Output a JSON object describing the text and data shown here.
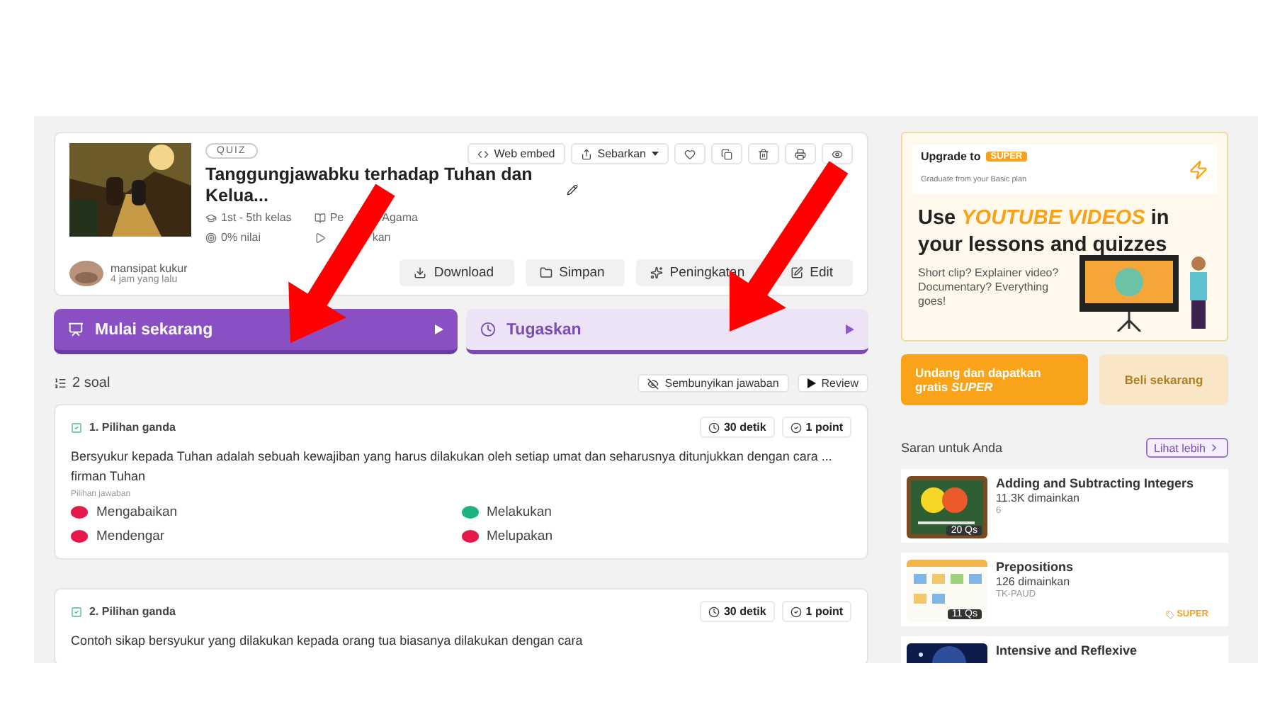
{
  "quiz": {
    "badge": "QUIZ",
    "title": "Tanggungjawabku terhadap Tuhan dan Kelua...",
    "meta": [
      {
        "kind": "grade",
        "text": "1st - 5th kelas"
      },
      {
        "kind": "subject",
        "parts": [
          "Pe",
          "Agama"
        ]
      },
      {
        "kind": "accuracy",
        "text": "0% nilai"
      },
      {
        "kind": "plays",
        "parts": [
          "kan"
        ]
      }
    ],
    "author": {
      "name": "mansipat kukur",
      "time": "4 jam yang lalu"
    },
    "toolbar": [
      {
        "kind": "embed",
        "label": "Web embed"
      },
      {
        "kind": "share",
        "label": "Sebarkan"
      },
      {
        "kind": "like"
      },
      {
        "kind": "copy"
      },
      {
        "kind": "delete"
      },
      {
        "kind": "print"
      },
      {
        "kind": "view"
      }
    ],
    "actions": [
      {
        "kind": "download",
        "label": "Download"
      },
      {
        "kind": "folder",
        "label": "Simpan"
      },
      {
        "kind": "enhance",
        "label": "Peningkatan"
      },
      {
        "kind": "edit",
        "label": "Edit"
      }
    ]
  },
  "cta": [
    {
      "kind": "start",
      "label": "Mulai sekarang"
    },
    {
      "kind": "assign",
      "label": "Tugaskan"
    }
  ],
  "questions_header": {
    "count": "2 soal",
    "buttons": [
      {
        "kind": "hide",
        "label": "Sembunyikan jawaban"
      },
      {
        "kind": "review",
        "label": "Review"
      }
    ]
  },
  "questions": [
    {
      "title": "1. Pilihan ganda",
      "time": "30 detik",
      "points": "1 point",
      "text": "Bersyukur kepada Tuhan adalah sebuah kewajiban yang harus dilakukan oleh setiap umat dan seharusnya ditunjukkan dengan cara ... firman Tuhan",
      "options_label": "Pilihan jawaban",
      "options": [
        {
          "text": "Mengabaikan",
          "correct": false
        },
        {
          "text": "Melakukan",
          "correct": true
        },
        {
          "text": "Mendengar",
          "correct": false
        },
        {
          "text": "Melupakan",
          "correct": false
        }
      ]
    },
    {
      "title": "2. Pilihan ganda",
      "time": "30 detik",
      "points": "1 point",
      "text": "Contoh sikap bersyukur yang dilakukan kepada orang tua biasanya dilakukan dengan cara"
    }
  ],
  "banner": {
    "upgrade": "Upgrade to",
    "super": "SUPER",
    "subtitle": "Graduate from your Basic plan",
    "headline": "Use **YOUTUBE VIDEOS** in your lessons and quizzes",
    "body": "Short clip? Explainer video? Documentary? Everything goes!"
  },
  "promo_buttons": [
    {
      "kind": "invite",
      "label": "Undang dan dapatkan gratis *SUPER*"
    },
    {
      "kind": "buy",
      "label": "Beli sekarang"
    }
  ],
  "suggestions": {
    "title": "Saran untuk Anda",
    "more": "Lihat lebih",
    "items": [
      {
        "kind": "math",
        "title": "Adding and Subtracting Integers",
        "plays": "11.3K dimainkan",
        "grade": "6",
        "count": "20 Qs"
      },
      {
        "kind": "chart",
        "title": "Prepositions",
        "plays": "126 dimainkan",
        "grade": "TK-PAUD",
        "count": "11 Qs",
        "tag": "SUPER"
      },
      {
        "kind": "space",
        "title": "Intensive and Reflexive"
      }
    ]
  }
}
